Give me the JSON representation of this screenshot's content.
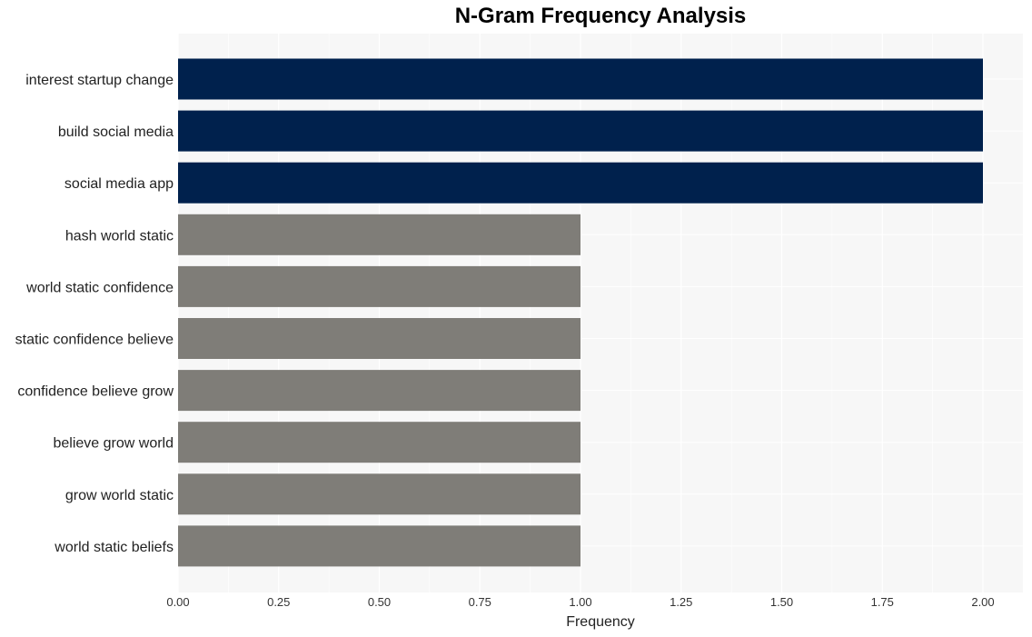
{
  "chart_data": {
    "type": "bar",
    "orientation": "horizontal",
    "title": "N-Gram Frequency Analysis",
    "xlabel": "Frequency",
    "ylabel": "",
    "xlim": [
      0,
      2.1
    ],
    "xticks": [
      0,
      0.25,
      0.5,
      0.75,
      1.0,
      1.25,
      1.5,
      1.75,
      2.0
    ],
    "xtick_labels": [
      "0.00",
      "0.25",
      "0.50",
      "0.75",
      "1.00",
      "1.25",
      "1.50",
      "1.75",
      "2.00"
    ],
    "grid": true,
    "categories": [
      "interest startup change",
      "build social media",
      "social media app",
      "hash world static",
      "world static confidence",
      "static confidence believe",
      "confidence believe grow",
      "believe grow world",
      "grow world static",
      "world static beliefs"
    ],
    "values": [
      2,
      2,
      2,
      1,
      1,
      1,
      1,
      1,
      1,
      1
    ],
    "colors": {
      "top": "#00214d",
      "other": "#7f7d78",
      "panel": "#f7f7f7",
      "grid": "#ffffff"
    }
  }
}
